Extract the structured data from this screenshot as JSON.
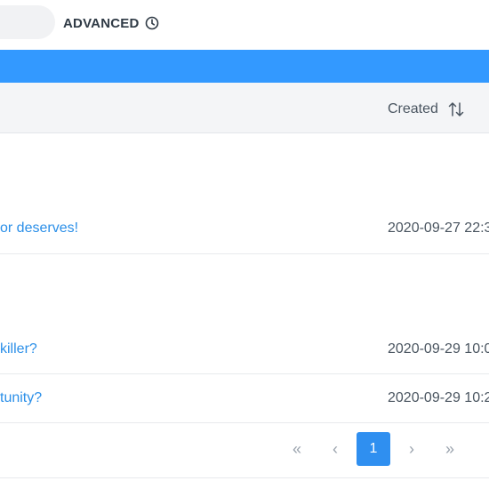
{
  "toolbar": {
    "advanced_label": "ADVANCED",
    "clock_icon": "clock-icon"
  },
  "colors": {
    "accent": "#3399ff",
    "link": "#2b8fe8",
    "header_bg": "#f4f5f7"
  },
  "table": {
    "columns": {
      "created": "Created",
      "sort_icon": "sort-arrows-icon"
    },
    "rows": [
      {
        "title": "",
        "created": ""
      },
      {
        "title": "or deserves!",
        "created": "2020-09-27 22:3"
      },
      {
        "title": "",
        "created": ""
      },
      {
        "title": "killer?",
        "created": "2020-09-29 10:0"
      },
      {
        "title": "tunity?",
        "created": "2020-09-29 10:2"
      }
    ]
  },
  "pagination": {
    "first": "«",
    "prev": "‹",
    "current": "1",
    "next": "›",
    "last": "»"
  }
}
